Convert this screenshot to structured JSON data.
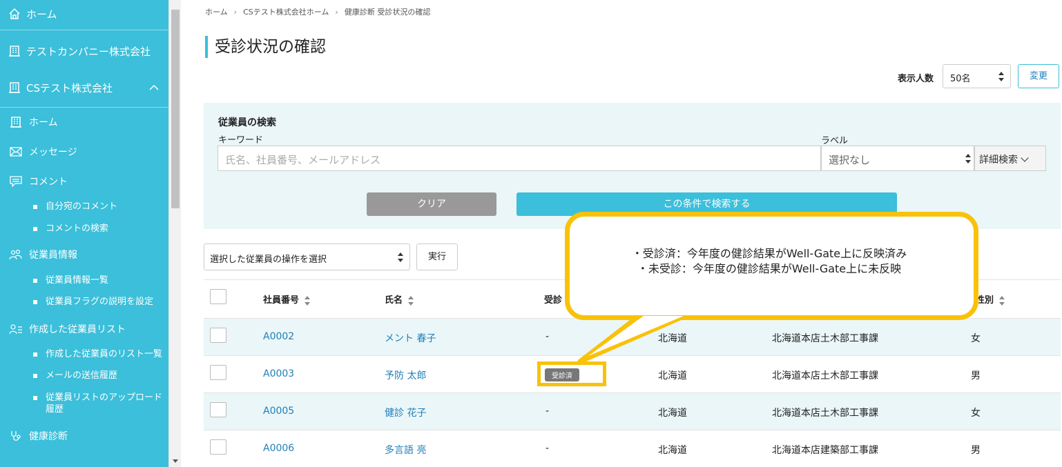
{
  "sidebar": {
    "top": [
      {
        "label": "ホーム",
        "icon": "home-icon"
      },
      {
        "label": "テストカンパニー株式会社",
        "icon": "building-icon"
      },
      {
        "label": "CSテスト株式会社",
        "icon": "building-icon"
      }
    ],
    "items": [
      {
        "label": "ホーム",
        "icon": "building-icon"
      },
      {
        "label": "メッセージ",
        "icon": "mail-icon"
      },
      {
        "label": "コメント",
        "icon": "comment-icon"
      },
      {
        "label": "自分宛のコメント"
      },
      {
        "label": "コメントの検索"
      },
      {
        "label": "従業員情報",
        "icon": "people-icon"
      },
      {
        "label": "従業員情報一覧"
      },
      {
        "label": "従業員フラグの説明を設定"
      },
      {
        "label": "作成した従業員リスト",
        "icon": "person-list-icon"
      },
      {
        "label": "作成した従業員のリスト一覧"
      },
      {
        "label": "メールの送信履歴"
      },
      {
        "label": "従業員リストのアップロード履歴"
      },
      {
        "label": "健康診断",
        "icon": "stethoscope-icon"
      }
    ],
    "color": "#3bbfda"
  },
  "breadcrumb": [
    "ホーム",
    "CSテスト株式会社ホーム",
    "健康診断 受診状況の確認"
  ],
  "page_title": "受診状況の確認",
  "display": {
    "label": "表示人数",
    "value": "50名",
    "button": "変更"
  },
  "search": {
    "title": "従業員の検索",
    "keyword_label": "キーワード",
    "keyword_placeholder": "氏名、社員番号、メールアドレス",
    "label_label": "ラベル",
    "label_value": "選択なし",
    "detail_button": "詳細検索",
    "clear_button": "クリア",
    "submit_button": "この条件で検索する"
  },
  "bulk": {
    "select_value": "選択した従業員の操作を選択",
    "run_button": "実行"
  },
  "table": {
    "headers": {
      "id": "社員番号",
      "name": "氏名",
      "status": "受診",
      "gender": "性別"
    },
    "rows": [
      {
        "id": "A0002",
        "name": "メント 春子",
        "status": "-",
        "region": "北海道",
        "dept": "北海道本店土木部工事課",
        "gender": "女"
      },
      {
        "id": "A0003",
        "name": "予防 太郎",
        "status": "受診済",
        "region": "北海道",
        "dept": "北海道本店土木部工事課",
        "gender": "男"
      },
      {
        "id": "A0005",
        "name": "健診 花子",
        "status": "-",
        "region": "北海道",
        "dept": "北海道本店土木部工事課",
        "gender": "女"
      },
      {
        "id": "A0006",
        "name": "多言語 亮",
        "status": "-",
        "region": "北海道",
        "dept": "北海道本店建築部工事課",
        "gender": "男"
      }
    ]
  },
  "callout": {
    "line1": "・受診済：今年度の健診結果がWell-Gate上に反映済み",
    "line2": "・未受診：今年度の健診結果がWell-Gate上に未反映",
    "color": "#f9c20a"
  }
}
